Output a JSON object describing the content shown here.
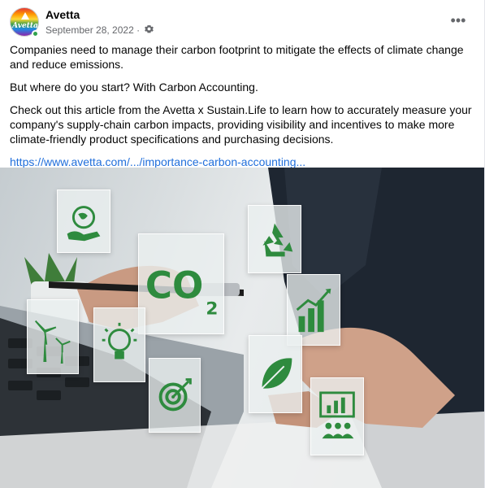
{
  "post": {
    "page_name": "Avetta",
    "avatar_label": "Avetta",
    "date": "September 28, 2022",
    "dot_separator": "·",
    "paragraphs": [
      "Companies need to manage their carbon footprint to mitigate the effects of climate change and reduce emissions.",
      "But where do you start?  With Carbon Accounting.",
      "Check out this article from the Avetta x Sustain.Life to learn how to accurately measure your company's supply-chain carbon impacts, providing visibility and incentives to make more climate-friendly product specifications and purchasing decisions."
    ],
    "link": "https://www.avetta.com/.../importance-carbon-accounting...",
    "more_label": "•••"
  },
  "image": {
    "co2_text": "CO",
    "co2_sub": "2"
  },
  "colors": {
    "icon_green": "#2e8b3e",
    "link_blue": "#216fdb",
    "meta_gray": "#65676b"
  },
  "icons": [
    "globe-hand-icon",
    "recycle-icon",
    "co2-icon",
    "bar-chart-icon",
    "wind-turbine-icon",
    "lightbulb-icon",
    "leaf-icon",
    "target-icon",
    "presentation-icon",
    "gear-icon",
    "more-icon"
  ]
}
